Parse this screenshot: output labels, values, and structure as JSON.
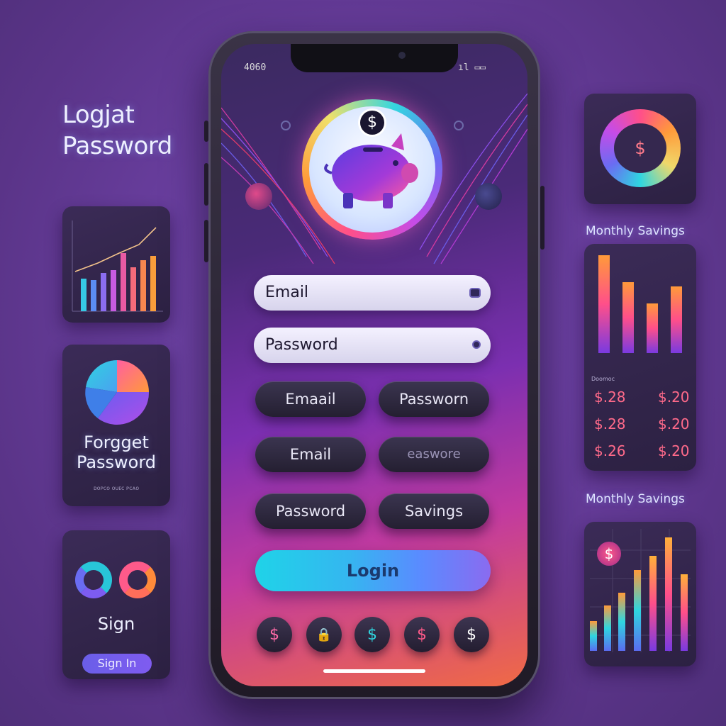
{
  "left_heading": {
    "line1": "Logjat",
    "line2": "Password"
  },
  "phone": {
    "status_time": "4060",
    "status_icons": "ıl ▭▭",
    "email_placeholder": "Email",
    "password_placeholder": "Password",
    "pills": [
      {
        "label": "Emaail"
      },
      {
        "label": "Passworn"
      },
      {
        "label": "Email"
      },
      {
        "label": "easwore"
      },
      {
        "label": "Password"
      },
      {
        "label": "Savings"
      }
    ],
    "login_label": "Login",
    "bottom_icons": [
      "$",
      "🔒",
      "$",
      "$",
      "$"
    ],
    "logo_coin": "$"
  },
  "left_cards": {
    "forget": {
      "line1": "Forgget",
      "line2": "Password",
      "small": "ᴅᴏᴘᴄᴏ ᴏᴜᴇᴄ ᴘᴄᴀᴏ"
    },
    "sign": {
      "title": "Sign",
      "button": "Sign In"
    }
  },
  "right_cards": {
    "ring_symbol": "$",
    "monthly_label_1": "Monthly Savings",
    "amounts_header": "Doomoc",
    "amounts": [
      {
        "left": "$.28",
        "right": "$.20"
      },
      {
        "left": "$.28",
        "right": "$.20"
      },
      {
        "left": "$.26",
        "right": "$.20"
      }
    ],
    "monthly_label_2": "Monthly Savings",
    "coin_symbol": "$"
  },
  "colors": {
    "accent_cyan": "#1fd3e8",
    "accent_pink": "#ff3f8e",
    "accent_orange": "#ff8a3a",
    "card_bg": "#2f2346"
  }
}
